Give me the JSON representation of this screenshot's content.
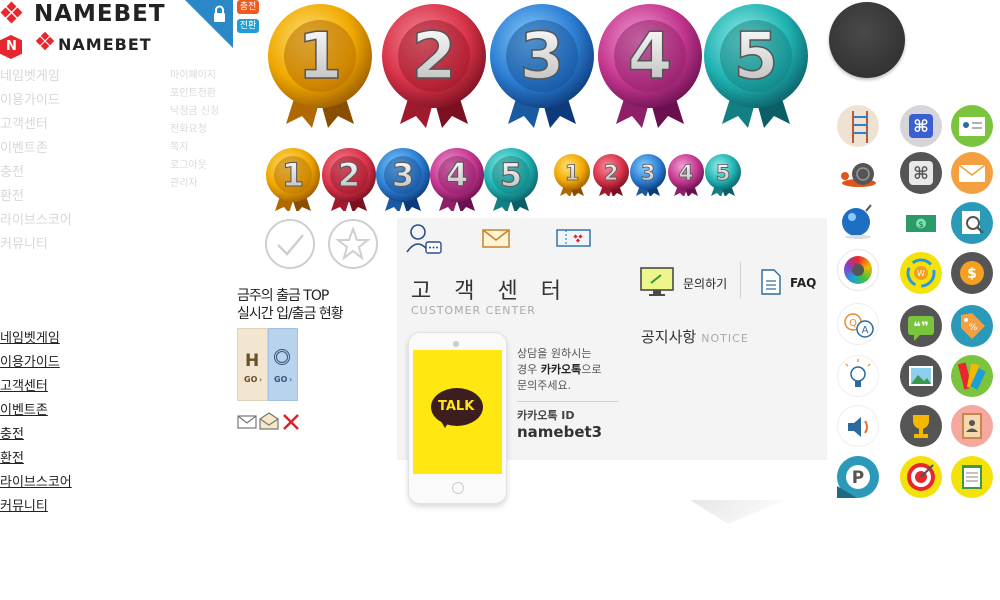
{
  "brand": {
    "name": "NAMEBET",
    "badge_letter": "N"
  },
  "top_badges": {
    "charge": "충전",
    "exchange": "전환"
  },
  "nav_faded": [
    "네임벳게임",
    "이용가이드",
    "고객센터",
    "이벤트존",
    "충전",
    "환전",
    "라이브스코어",
    "커뮤니티"
  ],
  "nav_sub": [
    "마이페이지",
    "포인트전환",
    "낙첨금 신청",
    "전화요청",
    "쪽지",
    "로그아웃",
    "관리자"
  ],
  "nav_main": [
    "네임벳게임",
    "이용가이드",
    "고객센터",
    "이벤트존",
    "충전",
    "환전",
    "라이브스코어",
    "커뮤니티"
  ],
  "medals": [
    "1",
    "2",
    "3",
    "4",
    "5"
  ],
  "top_weekly": {
    "line1": "금주의 출금 TOP",
    "line2": "실시간 입/출금 현황"
  },
  "go_buttons": {
    "go1": "GO",
    "go2": "GO"
  },
  "customer_center": {
    "title": "고 객 센 터",
    "subtitle": "CUSTOMER CENTER",
    "inquiry": "문의하기",
    "faq": "FAQ",
    "notice_title": "공지사항",
    "notice_sub": "NOTICE",
    "kakao_line1": "상담을 원하시는",
    "kakao_line2_pre": "경우",
    "kakao_line2_bold": "카카오톡",
    "kakao_line2_post": "으로",
    "kakao_line3": "문의주세요.",
    "kakao_id_label": "카카오톡 ID",
    "kakao_id": "namebet3",
    "talk": "TALK"
  },
  "colors": {
    "red": "#e8262e",
    "gold": "#f5b800",
    "medal_red": "#d9344a",
    "medal_blue": "#2d7fd4",
    "medal_pink": "#c5378f",
    "medal_teal": "#1fb2b2",
    "kakao": "#ffe812"
  }
}
